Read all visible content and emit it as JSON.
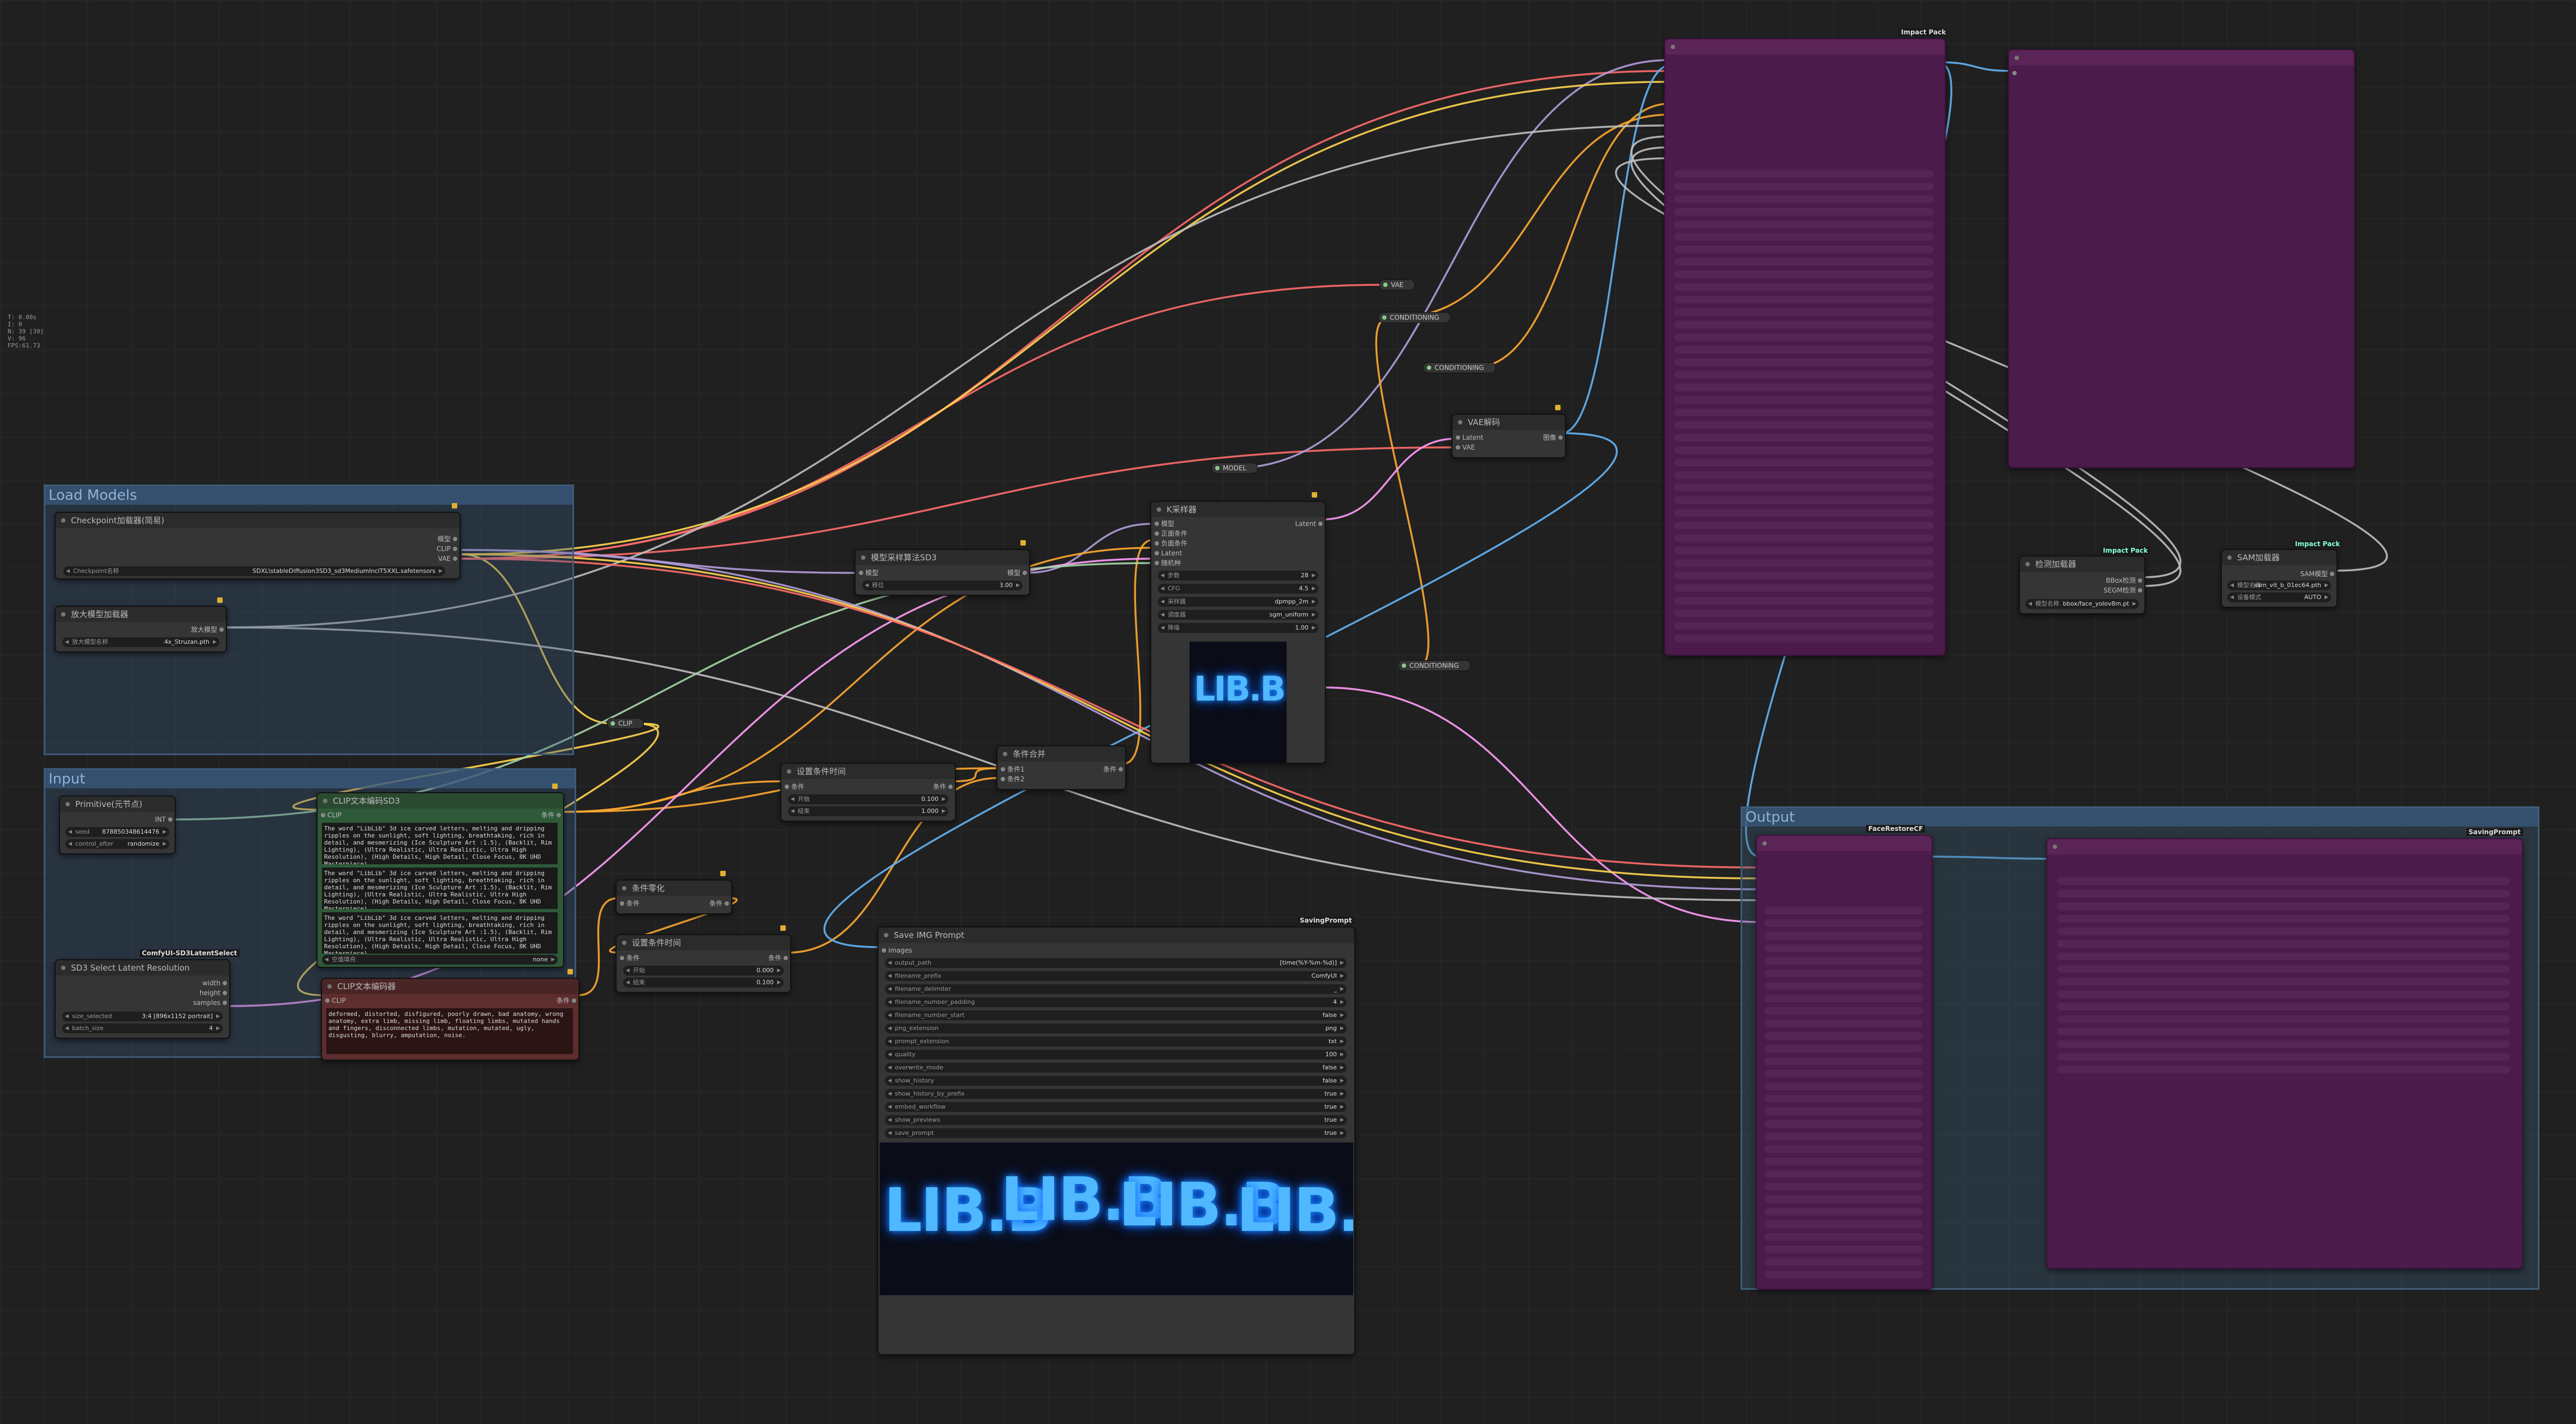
{
  "status": {
    "lines": [
      "T: 0.00s",
      "I: 0",
      "N: 39 [39]",
      "V: 96",
      "FPS:61.73"
    ]
  },
  "groups": {
    "load_models": "Load Models",
    "input": "Input",
    "output": "Output"
  },
  "nodes": {
    "checkpoint": {
      "title": "Checkpoint加载器(简易)",
      "outputs": [
        "模型",
        "CLIP",
        "VAE"
      ],
      "widget_label": "Checkpoint名称",
      "widget_value": "SDXL\\stableDiffusion3SD3_sd3MediumInclT5XXL.safetensors"
    },
    "upscale_loader": {
      "title": "放大模型加载器",
      "output": "放大模型",
      "widget_label": "放大模型名称",
      "widget_value": "4x_Struzan.pth"
    },
    "primitive": {
      "title": "Primitive(元节点)",
      "output": "INT",
      "widgets": [
        {
          "label": "seed",
          "value": "878850348614476"
        },
        {
          "label": "control_after",
          "value": "randomize"
        }
      ]
    },
    "clip_pos": {
      "title": "CLIP文本编码SD3",
      "input": "CLIP",
      "output": "条件",
      "text": "The word \"LibLib\" 3d ice carved letters, melting and dripping ripples on the sunlight, soft lighting, breathtaking, rich in detail, and mesmerizing (Ice Sculpture Art :1.5), (Backlit, Rim Lighting), (Ultra Realistic, Ultra Realistic, Ultra High Resolution), (High Details, High Detail, Close Focus, 8K UHD Masterpiece)",
      "widget_label": "空值填充",
      "widget_value": "none"
    },
    "sd3_resolution": {
      "title": "SD3 Select Latent Resolution",
      "badge": "ComfyUI-SD3LatentSelect",
      "outputs": [
        "width",
        "height",
        "samples"
      ],
      "widgets": [
        {
          "label": "size_selected",
          "value": "3:4 [896x1152 portrait]"
        },
        {
          "label": "batch_size",
          "value": "4"
        }
      ]
    },
    "clip_neg": {
      "title": "CLIP文本编码器",
      "input": "CLIP",
      "output": "条件",
      "text": "deformed, distorted, disfigured, poorly drawn, bad anatomy, wrong anatomy, extra limb, missing limb, floating limbs, mutated hands and fingers, disconnected limbs, mutation, mutated, ugly, disgusting, blurry, amputation, noise."
    },
    "model_sampling": {
      "title": "模型采样算法SD3",
      "input": "模型",
      "output": "模型",
      "widget_label": "移位",
      "widget_value": "3.00"
    },
    "ksampler": {
      "title": "K采样器",
      "inputs": [
        "模型",
        "正面条件",
        "负面条件",
        "Latent",
        "随机种"
      ],
      "output": "Latent",
      "widgets": [
        {
          "label": "步数",
          "value": "28"
        },
        {
          "label": "CFG",
          "value": "4.5"
        },
        {
          "label": "采样器",
          "value": "dpmpp_2m"
        },
        {
          "label": "调度器",
          "value": "sgm_uniform"
        },
        {
          "label": "降噪",
          "value": "1.00"
        }
      ]
    },
    "cond_timestep1": {
      "title": "设置条件时间",
      "input": "条件",
      "output": "条件",
      "widgets": [
        {
          "label": "开始",
          "value": "0.100"
        },
        {
          "label": "结束",
          "value": "1.000"
        }
      ]
    },
    "cond_combine": {
      "title": "条件合并",
      "inputs": [
        "条件1",
        "条件2"
      ],
      "output": "条件"
    },
    "cond_zero": {
      "title": "条件零化",
      "input": "条件",
      "output": "条件"
    },
    "cond_timestep2": {
      "title": "设置条件时间",
      "input": "条件",
      "output": "条件",
      "widgets": [
        {
          "label": "开始",
          "value": "0.000"
        },
        {
          "label": "结束",
          "value": "0.100"
        }
      ]
    },
    "vae_decode": {
      "title": "VAE解码",
      "inputs": [
        "Latent",
        "VAE"
      ],
      "output": "图像"
    },
    "save_img": {
      "title": "Save IMG Prompt",
      "badge": "SavingPrompt",
      "input": "images",
      "widgets": [
        {
          "label": "output_path",
          "value": "[time(%Y-%m-%d)]"
        },
        {
          "label": "filename_prefix",
          "value": "ComfyUI"
        },
        {
          "label": "filename_delimiter",
          "value": "_"
        },
        {
          "label": "filename_number_padding",
          "value": "4"
        },
        {
          "label": "filename_number_start",
          "value": "false"
        },
        {
          "label": "png_extension",
          "value": "png"
        },
        {
          "label": "prompt_extension",
          "value": "txt"
        },
        {
          "label": "quality",
          "value": "100"
        },
        {
          "label": "overwrite_mode",
          "value": "false"
        },
        {
          "label": "show_history",
          "value": "false"
        },
        {
          "label": "show_history_by_prefix",
          "value": "true"
        },
        {
          "label": "embed_workflow",
          "value": "true"
        },
        {
          "label": "show_previews",
          "value": "true"
        },
        {
          "label": "save_prompt",
          "value": "true"
        }
      ]
    },
    "bbox_loader": {
      "title": "检测加载器",
      "badge": "Impact Pack",
      "outputs": [
        "BBox检测",
        "SEGM检测"
      ],
      "widget_label": "模型名称",
      "widget_value": "bbox/face_yolov8m.pt"
    },
    "sam_loader": {
      "title": "SAM加载器",
      "badge": "Impact Pack",
      "output": "SAM模型",
      "widgets": [
        {
          "label": "模型名称",
          "value": "sam_vit_b_01ec64.pth"
        },
        {
          "label": "设备模式",
          "value": "AUTO"
        }
      ]
    },
    "face_detailer": {
      "badge": "Impact Pack"
    },
    "face_upscale": {
      "badge": "FaceRestoreCF"
    },
    "saving": {
      "badge": "SavingPrompt"
    }
  },
  "reroutes": {
    "vae": "VAE",
    "cond1": "CONDITIONING",
    "cond2": "CONDITIONING",
    "cond3": "CONDITIONING",
    "model": "MODEL",
    "clip": "CLIP"
  },
  "image_text": "LIB.B",
  "colors": {
    "model": "#b39ddb",
    "clip": "#ffd54f",
    "vae": "#ff6b6b",
    "cond": "#ffa931",
    "latent": "#ff9cf9",
    "image": "#64b5f6",
    "int": "#a5d6a7",
    "upscale": "#c0c0c0"
  }
}
